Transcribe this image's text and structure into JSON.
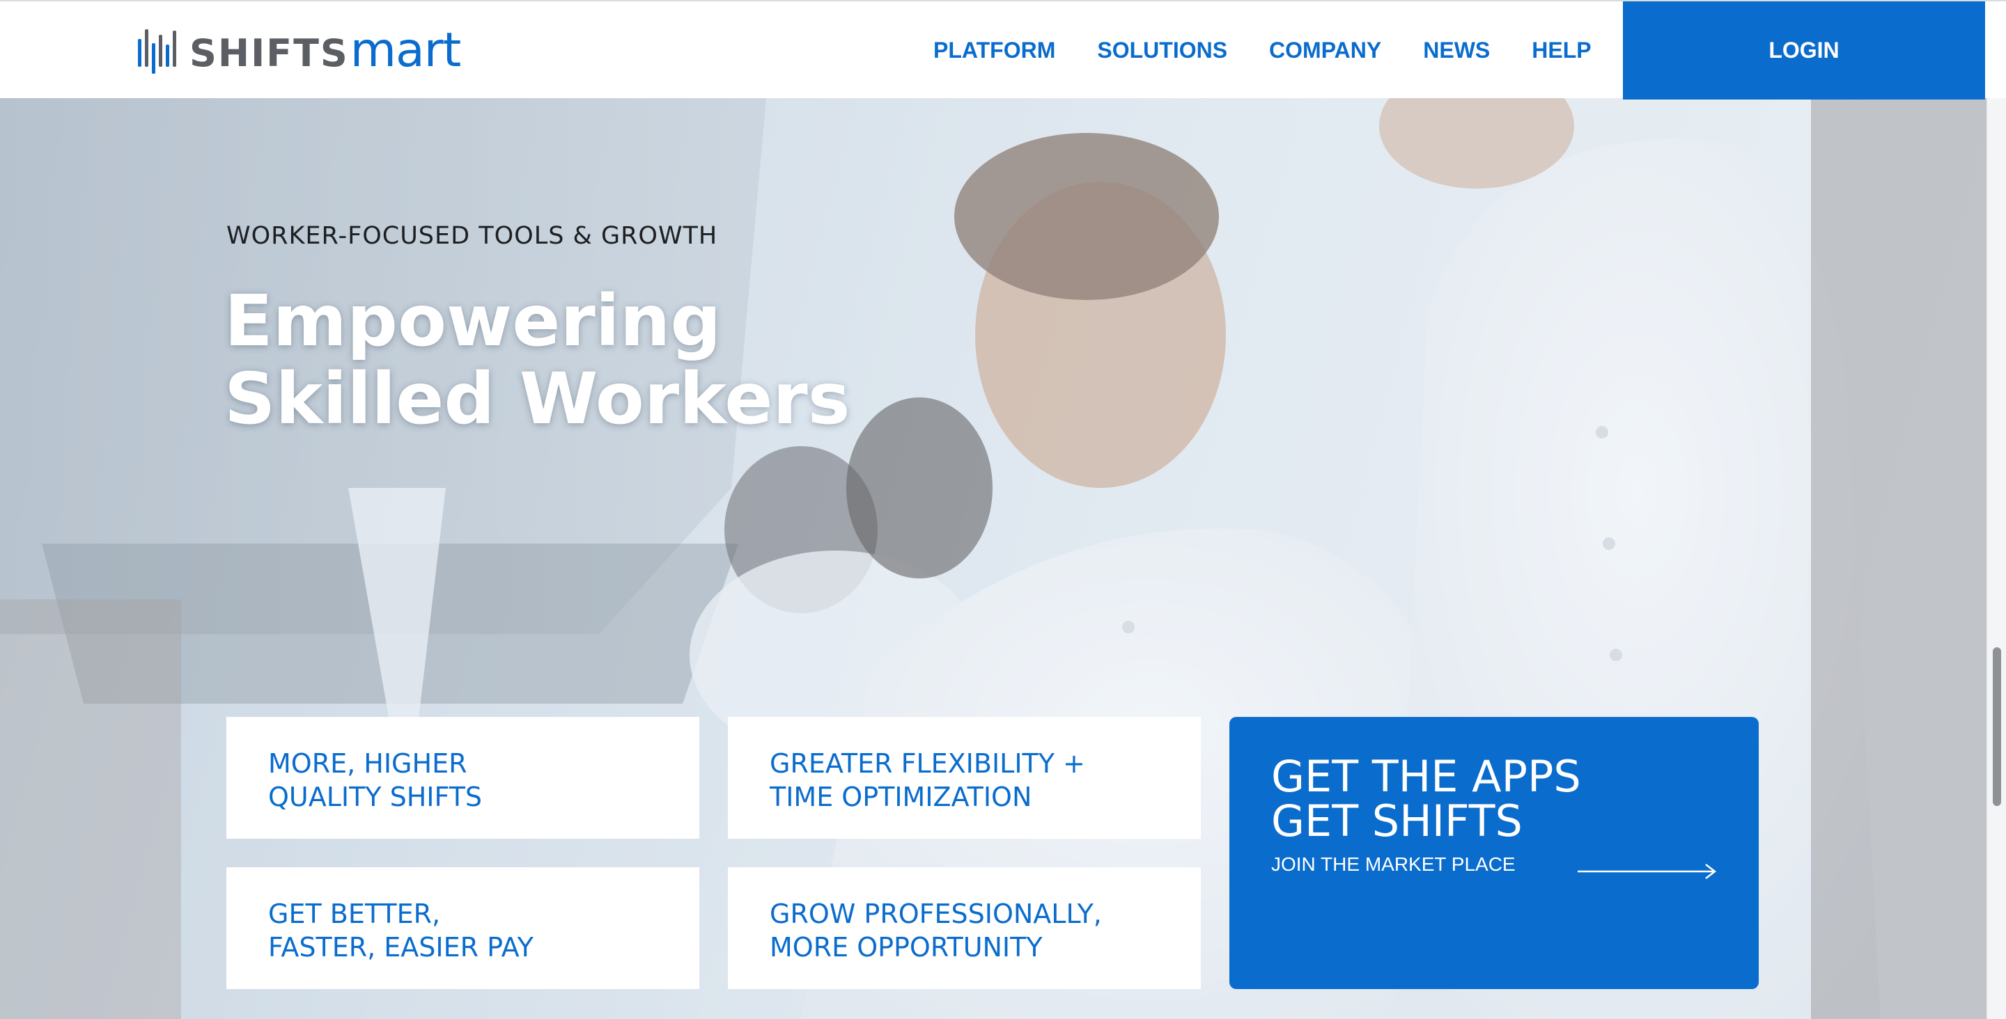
{
  "brand": {
    "logo_text_primary": "SHIFTS",
    "logo_text_secondary": "mart",
    "color_primary": "#0a6ccd",
    "color_logo_gray": "#5b5e63"
  },
  "nav": {
    "items": [
      {
        "label": "PLATFORM"
      },
      {
        "label": "SOLUTIONS"
      },
      {
        "label": "COMPANY"
      },
      {
        "label": "NEWS"
      },
      {
        "label": "HELP"
      }
    ],
    "login_label": "LOGIN"
  },
  "hero": {
    "eyebrow": "WORKER-FOCUSED TOOLS & GROWTH",
    "headline_line1": "Empowering",
    "headline_line2": "Skilled Workers",
    "tiles": [
      {
        "line1": "MORE, HIGHER",
        "line2": "QUALITY SHIFTS"
      },
      {
        "line1": "GREATER FLEXIBILITY +",
        "line2": "TIME OPTIMIZATION"
      },
      {
        "line1": "GET BETTER,",
        "line2": "FASTER, EASIER PAY"
      },
      {
        "line1": "GROW PROFESSIONALLY,",
        "line2": "MORE OPPORTUNITY"
      }
    ],
    "cta": {
      "title_line1": "GET THE APPS",
      "title_line2": "GET SHIFTS",
      "subtitle": "JOIN THE MARKET PLACE",
      "icon": "arrow-right-icon"
    }
  }
}
